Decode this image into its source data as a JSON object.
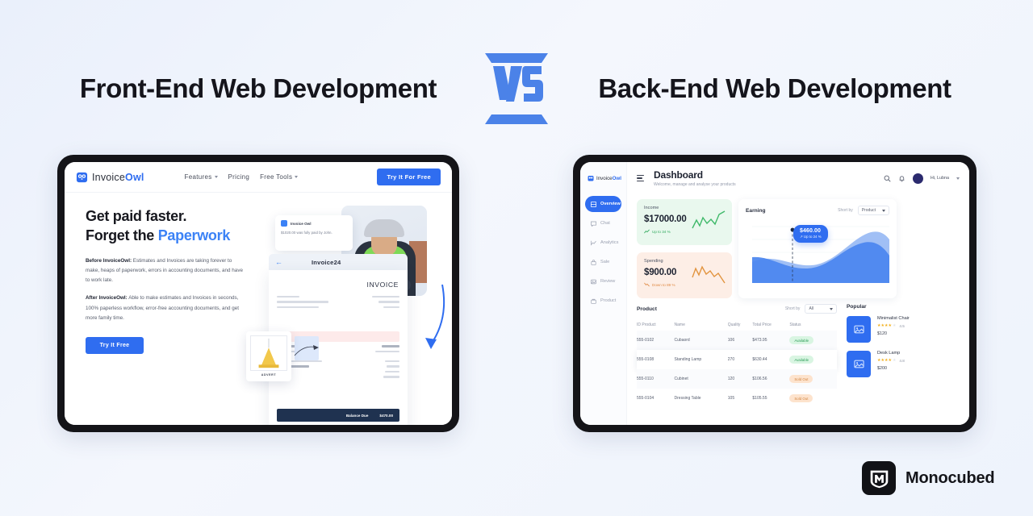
{
  "header": {
    "left_title": "Front-End Web Development",
    "right_title": "Back-End Web Development",
    "vs_label": "VS"
  },
  "colors": {
    "accent_blue": "#2f6df0",
    "light_blue": "#3b82f6",
    "green": "#2fa95c",
    "orange": "#e08b46",
    "dark": "#141418",
    "background": "#eef3fc"
  },
  "frontend_demo": {
    "nav": {
      "brand_first": "Invoice",
      "brand_second": "Owl",
      "links": [
        {
          "label": "Features",
          "has_caret": true
        },
        {
          "label": "Pricing",
          "has_caret": false
        },
        {
          "label": "Free Tools",
          "has_caret": true
        }
      ],
      "cta": "Try It For Free"
    },
    "hero": {
      "heading_line1": "Get paid faster.",
      "heading_line2_plain": "Forget the ",
      "heading_line2_accent": "Paperwork",
      "para1_bold": "Before InvoiceOwl:",
      "para1_rest": " Estimates and Invoices are taking forever to make, heaps of paperwork, errors in accounting documents, and have to work late.",
      "para2_bold": "After InvoiceOwl:",
      "para2_rest": " Able to make estimates and Invoices in seconds, 100% paperless workflow, error-free accounting documents, and get more family time.",
      "cta": "Try It Free"
    },
    "toast": {
      "title": "Invoice Owl",
      "body": "$1020.00 was fully paid by John."
    },
    "invoice": {
      "screen_title": "Invoice24",
      "doc_word": "INVOICE",
      "balance_label": "Balance Due",
      "balance_value": "$470.00"
    },
    "advert_label": "ADVERT"
  },
  "backend_demo": {
    "brand_first": "Invoice",
    "brand_second": "Owl",
    "page_title": "Dashboard",
    "page_subtitle": "Welcome, manage and analyse your products",
    "user_greeting": "Hi, Lubna",
    "sidebar": [
      {
        "label": "Overview",
        "icon": "grid-icon",
        "active": true
      },
      {
        "label": "Chat",
        "icon": "chat-icon",
        "active": false
      },
      {
        "label": "Analytics",
        "icon": "analytics-icon",
        "active": false
      },
      {
        "label": "Sale",
        "icon": "sale-icon",
        "active": false
      },
      {
        "label": "Review",
        "icon": "review-icon",
        "active": false
      },
      {
        "label": "Product",
        "icon": "product-icon",
        "active": false
      }
    ],
    "stats": [
      {
        "label": "Income",
        "value": "$17000.00",
        "delta": "Up to 34 %",
        "trend": "up"
      },
      {
        "label": "Spending",
        "value": "$900.00",
        "delta": "Down to 89 %",
        "trend": "down"
      }
    ],
    "earning": {
      "title": "Earning",
      "sort_label": "Short by",
      "sort_value": "Product",
      "tooltip_value": "$460.00",
      "tooltip_delta": "Up to 24 %"
    },
    "product": {
      "title": "Product",
      "sort_label": "Short by",
      "sort_value": "All",
      "columns": [
        "ID Product",
        "Name",
        "Quality",
        "Total Price",
        "Status"
      ],
      "rows": [
        {
          "id": "555-0102",
          "name": "Cubaord",
          "quality": "106",
          "price": "$473.95",
          "status": "Available",
          "state": "ok"
        },
        {
          "id": "555-0108",
          "name": "Standing Lamp",
          "quality": "270",
          "price": "$630.44",
          "status": "Available",
          "state": "ok"
        },
        {
          "id": "555-0110",
          "name": "Cubinet",
          "quality": "120",
          "price": "$106.56",
          "status": "Sold Out",
          "state": "out"
        },
        {
          "id": "555-0104",
          "name": "Dressing Table",
          "quality": "105",
          "price": "$105.55",
          "status": "Sold Out",
          "state": "out"
        }
      ]
    },
    "popular": {
      "title": "Popular",
      "items": [
        {
          "name": "Minimalist Chair",
          "rating": "4.5",
          "price": "$120"
        },
        {
          "name": "Desk Lamp",
          "rating": "4.8",
          "price": "$200"
        }
      ]
    }
  },
  "footer": {
    "brand": "Monocubed"
  }
}
